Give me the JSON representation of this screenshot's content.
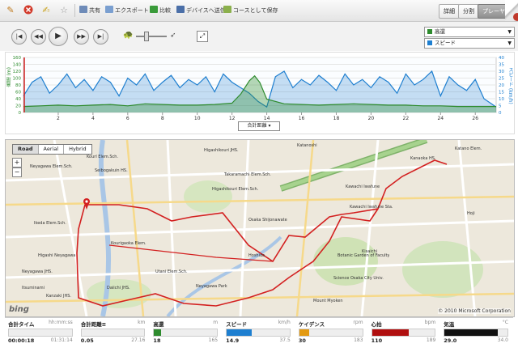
{
  "toolbar": {
    "share": "共有",
    "export": "エクスポート",
    "compare": "比較",
    "send_to_device": "デバイスへ送信",
    "save_as_course": "コースとして保存",
    "view_tabs": [
      "詳細",
      "分割",
      "プレーヤー"
    ]
  },
  "selectors": {
    "top": {
      "label": "高還",
      "color": "#2e8b2e"
    },
    "bottom": {
      "label": "スピード",
      "color": "#1e7fd0"
    }
  },
  "chart": {
    "left_axis_label": "高還 (m)",
    "right_axis_label": "スピード (km/h)",
    "x_axis_selector": "合計距離 ▾",
    "left_ticks": [
      "0",
      "20",
      "40",
      "60",
      "80",
      "100",
      "120",
      "140",
      "160"
    ],
    "right_ticks": [
      "0",
      "5",
      "10",
      "15",
      "20",
      "25",
      "30",
      "35",
      "40"
    ],
    "x_ticks": [
      "2",
      "4",
      "6",
      "8",
      "10",
      "12",
      "14",
      "16",
      "18",
      "20",
      "22",
      "24",
      "26"
    ]
  },
  "chart_data": {
    "type": "area",
    "x_range": [
      0,
      27.2
    ],
    "series": [
      {
        "axis": "left",
        "color": "#2e8b2e",
        "ylim": [
          0,
          165
        ],
        "x": [
          0,
          1,
          2,
          3,
          4,
          5,
          6,
          7,
          8,
          9,
          10,
          11,
          12,
          12.5,
          13,
          13.3,
          13.6,
          14,
          15,
          16,
          17,
          18,
          19,
          20,
          21,
          22,
          23,
          24,
          25,
          26,
          27.2
        ],
        "values": [
          18,
          20,
          22,
          20,
          22,
          24,
          20,
          26,
          24,
          22,
          22,
          24,
          28,
          55,
          95,
          110,
          90,
          40,
          26,
          24,
          22,
          24,
          26,
          24,
          22,
          22,
          20,
          20,
          18,
          18,
          18
        ]
      },
      {
        "axis": "right",
        "color": "#1e7fd0",
        "ylim": [
          0,
          40
        ],
        "x": [
          0,
          0.5,
          1,
          1.5,
          2,
          2.5,
          3,
          3.5,
          4,
          4.5,
          5,
          5.5,
          6,
          6.5,
          7,
          7.5,
          8,
          8.5,
          9,
          9.5,
          10,
          10.5,
          11,
          11.5,
          12,
          12.5,
          13,
          13.5,
          14,
          14.5,
          15,
          15.5,
          16,
          16.5,
          17,
          17.5,
          18,
          18.5,
          19,
          19.5,
          20,
          20.5,
          21,
          21.5,
          22,
          22.5,
          23,
          23.5,
          24,
          24.5,
          25,
          25.5,
          26,
          26.5,
          27.2
        ],
        "values": [
          12,
          22,
          26,
          14,
          20,
          28,
          18,
          24,
          16,
          26,
          22,
          12,
          25,
          20,
          28,
          16,
          22,
          27,
          18,
          24,
          20,
          26,
          15,
          28,
          22,
          18,
          14,
          8,
          4,
          26,
          30,
          18,
          24,
          20,
          27,
          22,
          16,
          28,
          20,
          24,
          18,
          26,
          22,
          14,
          28,
          20,
          24,
          30,
          12,
          26,
          20,
          16,
          24,
          10,
          4
        ]
      }
    ]
  },
  "map": {
    "types": [
      "Road",
      "Aerial",
      "Hybrid"
    ],
    "labels": [
      "Katano Elem.",
      "Kourl Elem.Sch.",
      "Higashikouri JHS.",
      "Neyagawa Elem.Sch.",
      "Seibogakuin HS.",
      "Takaramachi Elem.Sch.",
      "Higashikouri Elem.Sch.",
      "Katanoshi",
      "Kawachi Iwafune",
      "Kisaichi",
      "Hoshida",
      "Hoji",
      "Science Osaka City Univ.",
      "Osaka Shijonawate",
      "Higashi Neyagawa",
      "Ikeda Elem.Sch.",
      "Neyagawa JHS.",
      "Kourigaoka Elem.",
      "Utani Elem.Sch.",
      "Kanzaki JHS.",
      "Neyagawa Park",
      "Kanaoka HS.",
      "Daiichi JHS.",
      "Botanic Garden of Faculty",
      "Mount Myoken",
      "Kawachi Iwafune Sta.",
      "Itsuminami"
    ],
    "copyright": "© 2010 Microsoft Corporation",
    "logo": "bing"
  },
  "stats": [
    {
      "label": "合計タイム",
      "unit": "hh:mm:ss",
      "value": "00:00:18",
      "max": "01:31:14",
      "color": "#888888",
      "fraction": 0.0
    },
    {
      "label": "合計距離≡",
      "unit": "km",
      "value": "0.05",
      "max": "27.16",
      "color": "#888888",
      "fraction": 0.0
    },
    {
      "label": "高還",
      "unit": "m",
      "value": "18",
      "max": "165",
      "color": "#2e8b2e",
      "fraction": 0.11
    },
    {
      "label": "スピード",
      "unit": "km/h",
      "value": "14.9",
      "max": "37.5",
      "color": "#1e7fd0",
      "fraction": 0.4
    },
    {
      "label": "ケイデンス",
      "unit": "rpm",
      "value": "30",
      "max": "183",
      "color": "#e39a12",
      "fraction": 0.16
    },
    {
      "label": "心拍",
      "unit": "bpm",
      "value": "110",
      "max": "189",
      "color": "#b01010",
      "fraction": 0.58
    },
    {
      "label": "気温",
      "unit": "°C",
      "value": "29.0",
      "max": "34.0",
      "color": "#111111",
      "fraction": 0.85
    }
  ]
}
